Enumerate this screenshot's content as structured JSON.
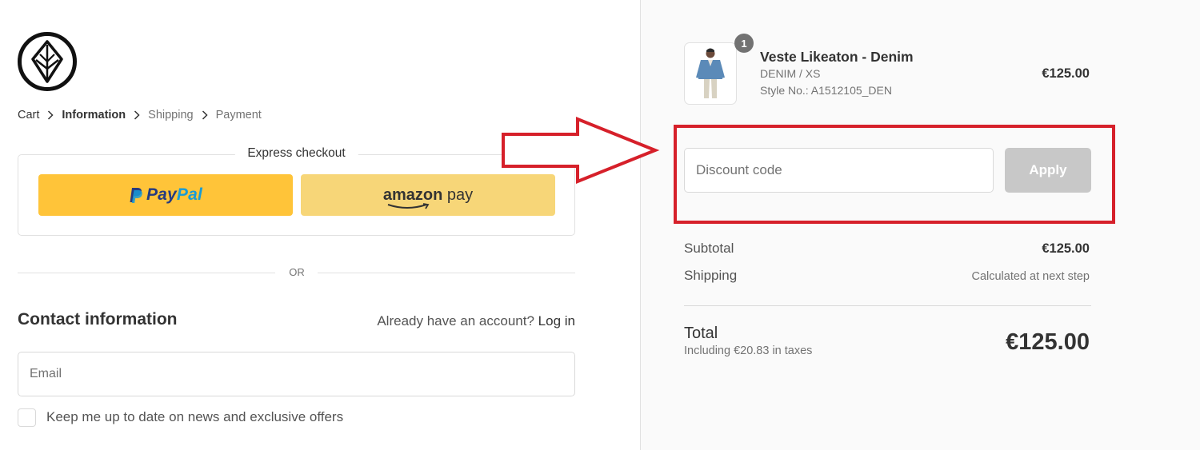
{
  "breadcrumb": {
    "items": [
      "Cart",
      "Information",
      "Shipping",
      "Payment"
    ],
    "active": "Information"
  },
  "express": {
    "title": "Express checkout",
    "paypal_label_1": "Pay",
    "paypal_label_2": "Pal",
    "amazon_label_1": "amazon",
    "amazon_label_2": " pay"
  },
  "divider_text": "OR",
  "contact": {
    "title": "Contact information",
    "account_prompt": "Already have an account?",
    "login_label": "Log in",
    "email_placeholder": "Email",
    "email_value": "",
    "newsletter_label": "Keep me up to date on news and exclusive offers",
    "newsletter_checked": false
  },
  "summary": {
    "product": {
      "quantity": "1",
      "name": "Veste Likeaton - Denim",
      "variant": "DENIM / XS",
      "style": "Style No.: A1512105_DEN",
      "price": "€125.00"
    },
    "discount": {
      "placeholder": "Discount code",
      "value": "",
      "apply_label": "Apply"
    },
    "subtotal_label": "Subtotal",
    "subtotal_value": "€125.00",
    "shipping_label": "Shipping",
    "shipping_value": "Calculated at next step",
    "total_label": "Total",
    "taxes_note": "Including €20.83 in taxes",
    "total_value": "€125.00"
  },
  "colors": {
    "paypal_button": "#ffc439",
    "amazon_button": "#f7d678",
    "annotation_red": "#d6202a",
    "apply_disabled": "#c8c8c8",
    "summary_bg": "#fafafa"
  },
  "icons": [
    "volcom-stone-logo-icon",
    "chevron-right-icon",
    "paypal-p-icon",
    "amazon-smile-icon",
    "annotation-arrow-icon"
  ]
}
